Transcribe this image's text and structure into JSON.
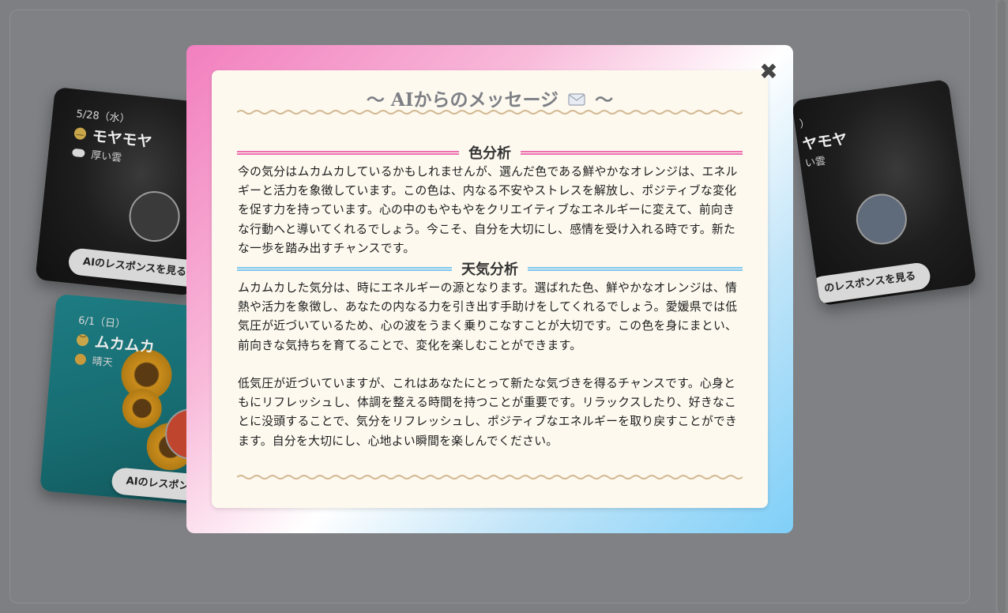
{
  "background_cards": [
    {
      "date": "5/28（水）",
      "mood": "モヤモヤ",
      "weather": "厚い雲",
      "button_label": "AIのレスポンスを見る",
      "color": "#3a3a3a"
    },
    {
      "date": "6/1（日）",
      "mood": "ムカムカ",
      "weather": "晴天",
      "button_label": "AIのレスポンスを見る",
      "color": "#c0452f"
    },
    {
      "date": "）",
      "mood": "ヤモヤ",
      "weather": "い雲",
      "button_label": "のレスポンスを見る",
      "color": "#5f6a7a"
    }
  ],
  "modal": {
    "title_prefix": "〜 AIからのメッセージ",
    "title_suffix": "〜",
    "title_icon": "envelope-icon",
    "close_label": "✖",
    "sections": [
      {
        "heading": "色分析",
        "accent": "#ee6fb0",
        "text": "今の気分はムカムカしているかもしれませんが、選んだ色である鮮やかなオレンジは、エネルギーと活力を象徴しています。この色は、内なる不安やストレスを解放し、ポジティブな変化を促す力を持っています。心の中のもやもやをクリエイティブなエネルギーに変えて、前向きな行動へと導いてくれるでしょう。今こそ、自分を大切にし、感情を受け入れる時です。新たな一歩を踏み出すチャンスです。"
      },
      {
        "heading": "天気分析",
        "accent": "#7ec8ef",
        "text": "ムカムカした気分は、時にエネルギーの源となります。選ばれた色、鮮やかなオレンジは、情熱や活力を象徴し、あなたの内なる力を引き出す手助けをしてくれるでしょう。愛媛県では低気圧が近づいているため、心の波をうまく乗りこなすことが大切です。この色を身にまとい、前向きな気持ちを育てることで、変化を楽しむことができます。",
        "text2": "低気圧が近づいていますが、これはあなたにとって新たな気づきを得るチャンスです。心身ともにリフレッシュし、体調を整える時間を持つことが重要です。リラックスしたり、好きなことに没頭することで、気分をリフレッシュし、ポジティブなエネルギーを取り戻すことができます。自分を大切にし、心地よい瞬間を楽しんでください。"
      }
    ]
  }
}
